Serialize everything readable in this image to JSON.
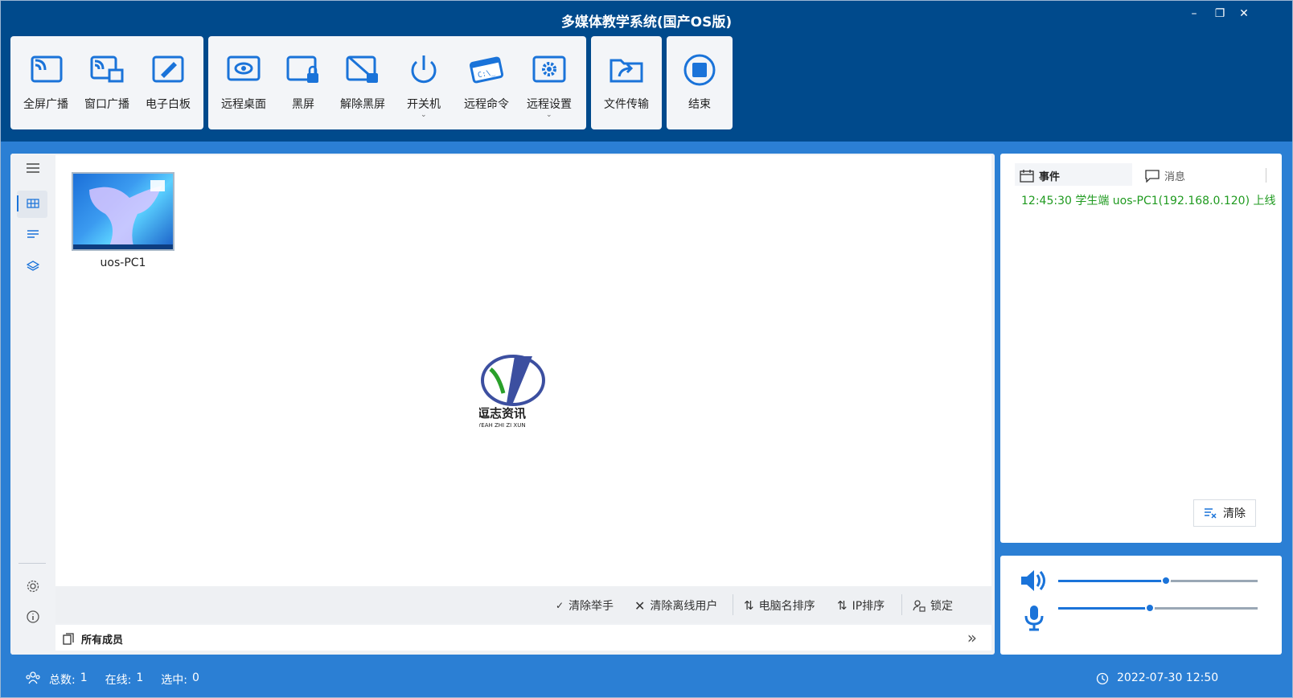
{
  "window": {
    "title": "多媒体教学系统(国产OS版)",
    "controls": {
      "minimize": "–",
      "restore": "❐",
      "close": "✕"
    }
  },
  "toolbar": {
    "buttons": {
      "fullscreen_broadcast": "全屏广播",
      "window_broadcast": "窗口广播",
      "whiteboard": "电子白板",
      "remote_desktop": "远程桌面",
      "black_screen": "黑屏",
      "unblack_screen": "解除黑屏",
      "power": "开关机",
      "remote_command": "远程命令",
      "remote_settings": "远程设置",
      "file_transfer": "文件传输",
      "end": "结束"
    },
    "command_icon_text": "C:\\_",
    "accent": "#1a73d9"
  },
  "students": [
    {
      "name": "uos-PC1"
    }
  ],
  "actions": {
    "clear_hands": "清除举手",
    "clear_offline": "清除离线用户",
    "sort_name": "电脑名排序",
    "sort_ip": "IP排序",
    "lock": "锁定"
  },
  "group_bar": {
    "all_members": "所有成员",
    "more": "»"
  },
  "right_panel": {
    "tab_events": "事件",
    "tab_messages": "消息",
    "events": [
      "12:45:30 学生端 uos-PC1(192.168.0.120) 上线"
    ],
    "clear_button": "清除",
    "event_color": "#1f9a1f"
  },
  "audio": {
    "speaker_level": 0.54,
    "mic_level": 0.46
  },
  "status": {
    "total_label": "总数:",
    "total": "1",
    "online_label": "在线:",
    "online": "1",
    "selected_label": "选中:",
    "selected": "0",
    "datetime": "2022-07-30 12:50"
  },
  "logo_text": {
    "cn": "逗志资讯",
    "pinyin": "YEAH ZHI ZI XUN"
  }
}
